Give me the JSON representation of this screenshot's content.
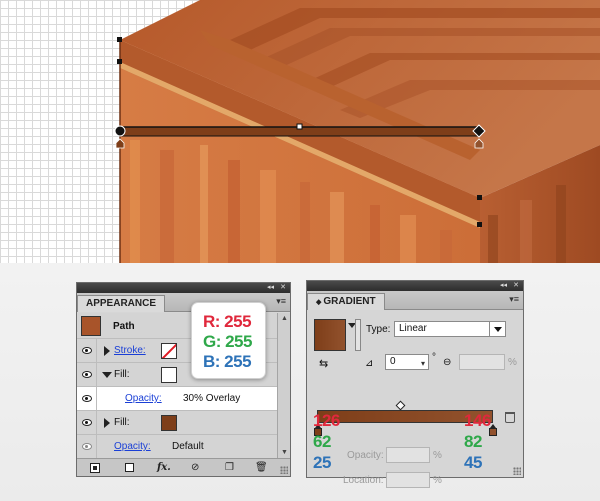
{
  "appearance_panel": {
    "tab_label": "APPEARANCE",
    "header_title": "Path",
    "rows": {
      "stroke_label": "Stroke:",
      "fill1_label": "Fill:",
      "fill1_opacity_label": "Opacity:",
      "fill1_opacity_value": "30% Overlay",
      "fill2_label": "Fill:",
      "object_opacity_label": "Opacity:",
      "object_opacity_value": "Default"
    },
    "footer": {
      "fx_label": "fx."
    }
  },
  "rgb_tooltip": {
    "r": "R: 255",
    "g": "G: 255",
    "b": "B: 255"
  },
  "gradient_panel": {
    "tab_label": "GRADIENT",
    "type_label": "Type:",
    "type_value": "Linear",
    "angle_value": "0",
    "angle_unit": "°",
    "aspect_unit": "%",
    "opacity_label": "Opacity:",
    "opacity_unit": "%",
    "location_label": "Location:",
    "location_unit": "%",
    "left_stop": {
      "r": "126",
      "g": "62",
      "b": "25",
      "color": "#7e3e19"
    },
    "right_stop": {
      "r": "146",
      "g": "82",
      "b": "45",
      "color": "#92522d"
    }
  },
  "colors": {
    "red": "#e0283c",
    "green": "#2fa84a",
    "blue": "#2e73b8",
    "path_fill": "#7e3e19",
    "fill_swatch_2": "#7e3e19"
  }
}
